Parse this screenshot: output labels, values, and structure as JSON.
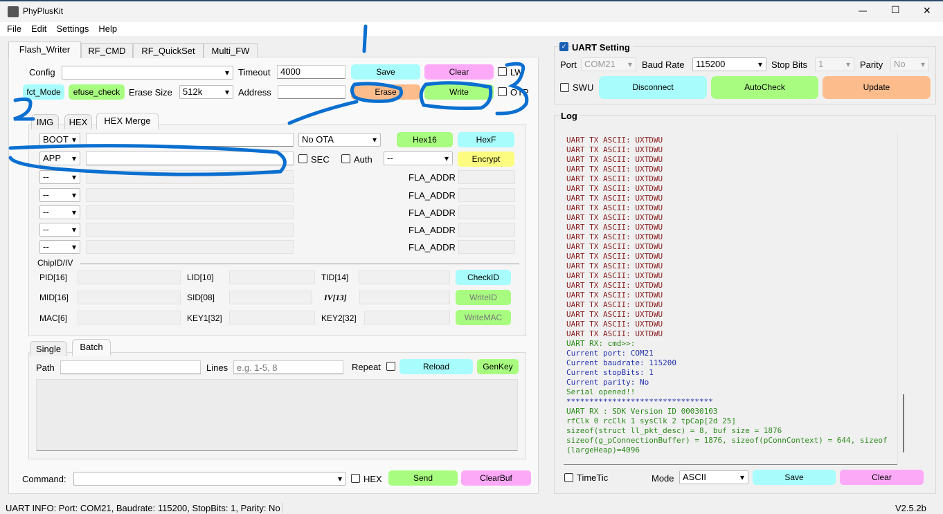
{
  "window": {
    "title": "PhyPlusKit",
    "minimize": "—",
    "maximize": "☐",
    "close": "✕"
  },
  "menu": [
    "File",
    "Edit",
    "Settings",
    "Help"
  ],
  "main_tabs": [
    "Flash_Writer",
    "RF_CMD",
    "RF_QuickSet",
    "Multi_FW"
  ],
  "flash": {
    "config_label": "Config",
    "config_value": "",
    "timeout_label": "Timeout",
    "timeout_value": "4000",
    "save": "Save",
    "clear": "Clear",
    "lw": "LW",
    "fct_mode": "fct_Mode",
    "efuse_check": "efuse_check",
    "erase_size_label": "Erase Size",
    "erase_size_value": "512k",
    "address_label": "Address",
    "address_value": "",
    "erase": "Erase",
    "write": "Write",
    "otp": "OTP"
  },
  "sub_tabs": [
    "IMG",
    "HEX",
    "HEX Merge"
  ],
  "hexmerge": {
    "boot": "BOOT",
    "ota": "No OTA",
    "hex16": "Hex16",
    "hexf": "HexF",
    "app": "APP",
    "sec": "SEC",
    "auth": "Auth",
    "auth_select": "--",
    "encrypt": "Encrypt",
    "extra_rows": [
      {
        "sel": "--",
        "addr_label": "FLA_ADDR"
      },
      {
        "sel": "--",
        "addr_label": "FLA_ADDR"
      },
      {
        "sel": "--",
        "addr_label": "FLA_ADDR"
      },
      {
        "sel": "--",
        "addr_label": "FLA_ADDR"
      },
      {
        "sel": "--",
        "addr_label": "FLA_ADDR"
      }
    ]
  },
  "chipid": {
    "title": "ChipID/IV",
    "labels": [
      [
        "PID[16]",
        "LID[10]",
        "TID[14]"
      ],
      [
        "MID[16]",
        "SID[08]",
        "IV[13]"
      ],
      [
        "MAC[6]",
        "KEY1[32]",
        "KEY2[32]"
      ]
    ],
    "check_id": "CheckID",
    "write_id": "WriteID",
    "write_mac": "WriteMAC"
  },
  "batch_tabs": [
    "Single",
    "Batch"
  ],
  "batch": {
    "path_label": "Path",
    "path_value": "",
    "lines_label": "Lines",
    "lines_placeholder": "e.g. 1-5, 8",
    "repeat": "Repeat",
    "reload": "Reload",
    "genkey": "GenKey"
  },
  "command": {
    "label": "Command:",
    "value": "",
    "hex": "HEX",
    "send": "Send",
    "clearbuf": "ClearBuf"
  },
  "uart": {
    "title": "UART Setting",
    "enabled": true,
    "port_label": "Port",
    "port": "COM21",
    "baud_label": "Baud Rate",
    "baud": "115200",
    "stop_label": "Stop Bits",
    "stop": "1",
    "parity_label": "Parity",
    "parity": "No",
    "swu": "SWU",
    "disconnect": "Disconnect",
    "autocheck": "AutoCheck",
    "update": "Update"
  },
  "log": {
    "title": "Log",
    "lines": [
      {
        "t": "UART TX ASCII: UXTDWU",
        "c": "tx"
      },
      {
        "t": "UART TX ASCII: UXTDWU",
        "c": "tx"
      },
      {
        "t": "UART TX ASCII: UXTDWU",
        "c": "tx"
      },
      {
        "t": "UART TX ASCII: UXTDWU",
        "c": "tx"
      },
      {
        "t": "UART TX ASCII: UXTDWU",
        "c": "tx"
      },
      {
        "t": "UART TX ASCII: UXTDWU",
        "c": "tx"
      },
      {
        "t": "UART TX ASCII: UXTDWU",
        "c": "tx"
      },
      {
        "t": "UART TX ASCII: UXTDWU",
        "c": "tx"
      },
      {
        "t": "UART TX ASCII: UXTDWU",
        "c": "tx"
      },
      {
        "t": "UART TX ASCII: UXTDWU",
        "c": "tx"
      },
      {
        "t": "UART TX ASCII: UXTDWU",
        "c": "tx"
      },
      {
        "t": "UART TX ASCII: UXTDWU",
        "c": "tx"
      },
      {
        "t": "UART TX ASCII: UXTDWU",
        "c": "tx"
      },
      {
        "t": "UART TX ASCII: UXTDWU",
        "c": "tx"
      },
      {
        "t": "UART TX ASCII: UXTDWU",
        "c": "tx"
      },
      {
        "t": "UART TX ASCII: UXTDWU",
        "c": "tx"
      },
      {
        "t": "UART TX ASCII: UXTDWU",
        "c": "tx"
      },
      {
        "t": "UART TX ASCII: UXTDWU",
        "c": "tx"
      },
      {
        "t": "UART TX ASCII: UXTDWU",
        "c": "tx"
      },
      {
        "t": "UART TX ASCII: UXTDWU",
        "c": "tx"
      },
      {
        "t": "UART TX ASCII: UXTDWU",
        "c": "tx"
      },
      {
        "t": "UART RX: cmd>>:",
        "c": "rx"
      },
      {
        "t": "Current port: COM21",
        "c": "info"
      },
      {
        "t": "Current baudrate: 115200",
        "c": "info"
      },
      {
        "t": "Current stopBits: 1",
        "c": "info"
      },
      {
        "t": "Current parity: No",
        "c": "info"
      },
      {
        "t": "Serial opened!!",
        "c": "rx"
      },
      {
        "t": "********************************",
        "c": "info"
      },
      {
        "t": "UART RX : SDK Version ID 00030103",
        "c": "rx"
      },
      {
        "t": "rfClk 0 rcClk 1 sysClk 2 tpCap[2d 25]",
        "c": "rx"
      },
      {
        "t": "sizeof(struct ll_pkt_desc) = 8, buf size = 1876",
        "c": "rx"
      },
      {
        "t": "sizeof(g_pConnectionBuffer) = 1876, sizeof(pConnContext) = 644, sizeof",
        "c": "rx"
      },
      {
        "t": "(largeHeap)=4096",
        "c": "rx"
      }
    ],
    "timetic": "TimeTic",
    "mode_label": "Mode",
    "mode": "ASCII",
    "save": "Save",
    "clear": "Clear"
  },
  "status": {
    "info": "UART INFO: Port: COM21, Baudrate: 115200, StopBits: 1, Parity: No",
    "version": "V2.5.2b"
  },
  "annotations": {
    "ink_color": "#0a6fd0",
    "marks": [
      "1",
      "2",
      "3"
    ]
  }
}
